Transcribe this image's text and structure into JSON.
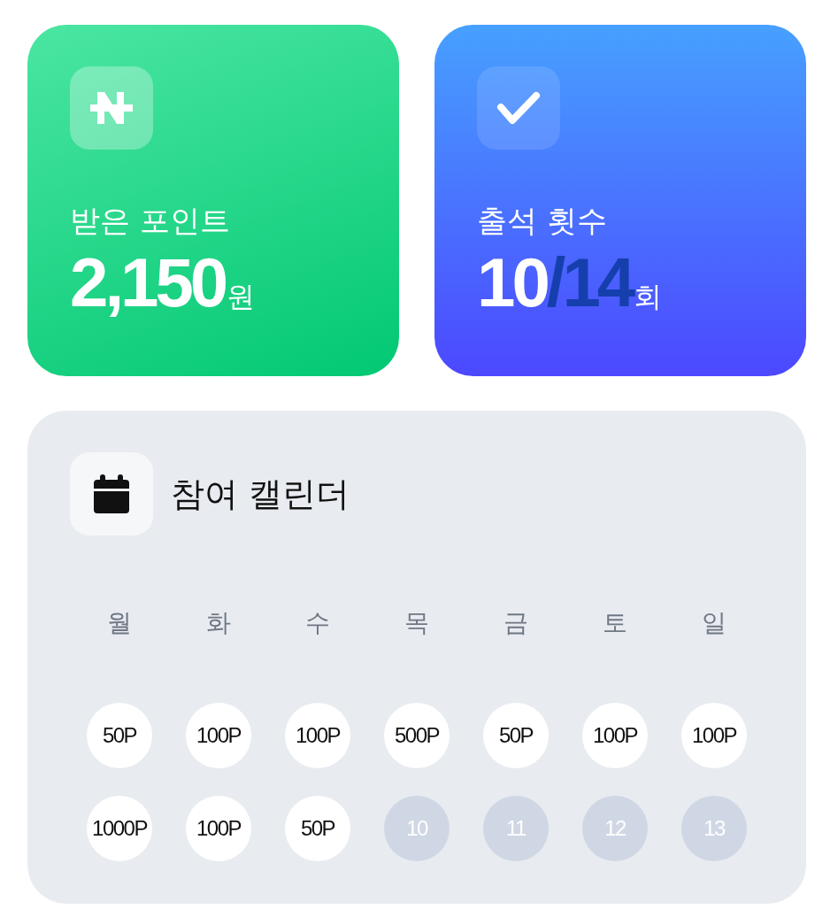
{
  "stats": [
    {
      "kind": "points",
      "label": "받은 포인트",
      "value": "2,150",
      "unit": "원"
    },
    {
      "kind": "attendance",
      "label": "출석 횟수",
      "value": "10",
      "total": "/14",
      "unit": "회"
    }
  ],
  "calendar": {
    "title": "참여 캘린더",
    "weekdays": [
      "월",
      "화",
      "수",
      "목",
      "금",
      "토",
      "일"
    ],
    "days": [
      {
        "text": "50P",
        "attended": true
      },
      {
        "text": "100P",
        "attended": true
      },
      {
        "text": "100P",
        "attended": true
      },
      {
        "text": "500P",
        "attended": true
      },
      {
        "text": "50P",
        "attended": true
      },
      {
        "text": "100P",
        "attended": true
      },
      {
        "text": "100P",
        "attended": true
      },
      {
        "text": "1000P",
        "attended": true
      },
      {
        "text": "100P",
        "attended": true
      },
      {
        "text": "50P",
        "attended": true
      },
      {
        "text": "10",
        "attended": false
      },
      {
        "text": "11",
        "attended": false
      },
      {
        "text": "12",
        "attended": false
      },
      {
        "text": "13",
        "attended": false
      }
    ]
  }
}
